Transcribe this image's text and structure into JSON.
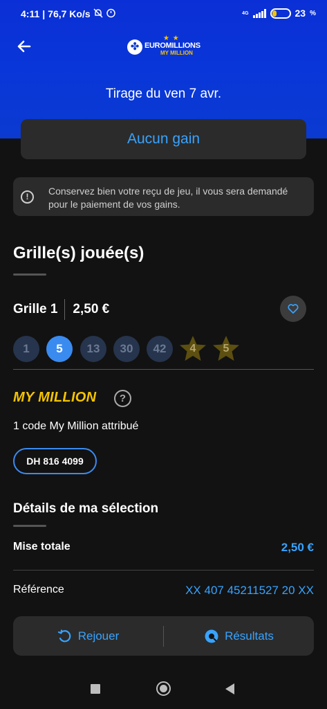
{
  "status_bar": {
    "time": "4:11",
    "speed": "76,7 Ko/s",
    "network": "4G",
    "battery": "23",
    "battery_unit": "%",
    "battery_level": 0.23
  },
  "header": {
    "logo_brand": "EUROMILLIONS",
    "logo_sub": "MY MILLION",
    "draw_title": "Tirage du ven 7 avr."
  },
  "result": {
    "label": "Aucun gain"
  },
  "notice": {
    "text": "Conservez bien votre reçu de jeu, il vous sera demandé pour le paiement de vos gains."
  },
  "grids_section": {
    "title": "Grille(s) jouée(s)",
    "grid_label": "Grille 1",
    "grid_price": "2,50 €",
    "numbers": [
      {
        "value": "1",
        "won": false
      },
      {
        "value": "5",
        "won": true
      },
      {
        "value": "13",
        "won": false
      },
      {
        "value": "30",
        "won": false
      },
      {
        "value": "42",
        "won": false
      }
    ],
    "stars": [
      "4",
      "5"
    ]
  },
  "my_million": {
    "title": "MY MILLION",
    "count_text": "1 code My Million attribué",
    "code": "DH 816 4099"
  },
  "details": {
    "title": "Détails de ma sélection",
    "rows": [
      {
        "label": "Mise totale",
        "value": "2,50 €"
      },
      {
        "label": "Référence",
        "value": "XX 407 45211527 20 XX"
      }
    ]
  },
  "bottom_bar": {
    "replay_label": "Rejouer",
    "results_label": "Résultats"
  },
  "colors": {
    "accent": "#38a3ff",
    "header_blue": "#0a3ad0",
    "gold": "#f5c400",
    "surface": "#2b2b2b",
    "background": "#121212"
  }
}
